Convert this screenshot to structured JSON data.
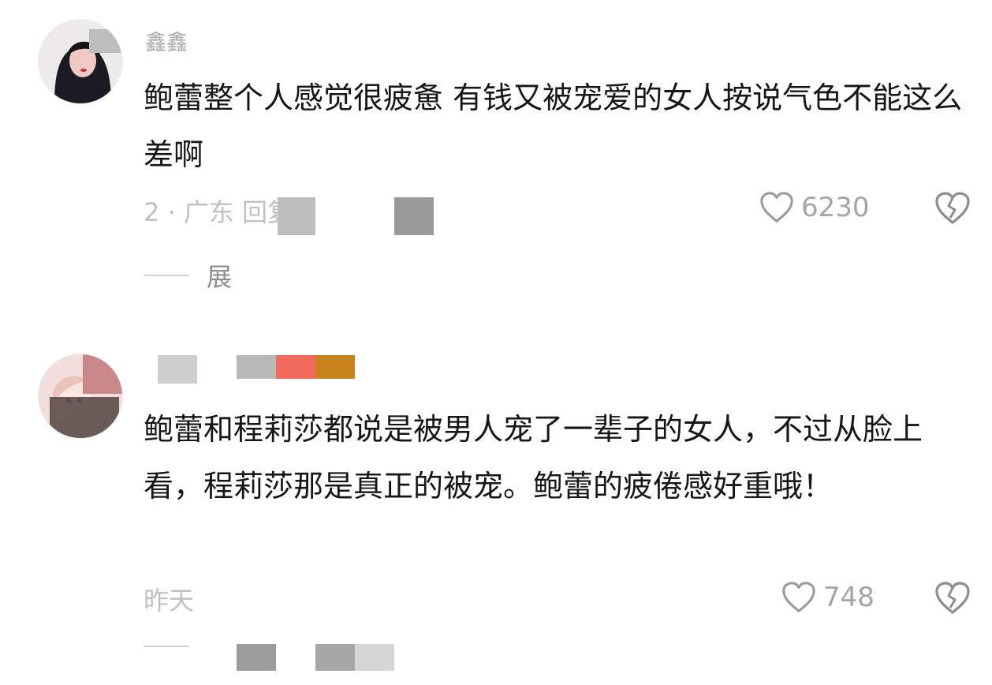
{
  "comments": [
    {
      "username": "鑫鑫",
      "text": "鲍蕾整个人感觉很疲惫 有钱又被宠爱的女人按说气色不能这么差啊",
      "meta": "2  ·  广东  回复",
      "likes": "6230",
      "replies_label": "展"
    },
    {
      "username": "",
      "text": "鲍蕾和程莉莎都说是被男人宠了一辈子的女人，不过从脸上看，程莉莎那是真正的被宠。鲍蕾的疲倦感好重哦！",
      "meta": "昨天",
      "likes": "748",
      "replies_label": ""
    }
  ],
  "icons": {
    "like": "heart-outline-icon",
    "dislike": "broken-heart-icon"
  },
  "colors": {
    "text": "#161616",
    "muted": "#a5a5a5",
    "background": "#ffffff"
  }
}
